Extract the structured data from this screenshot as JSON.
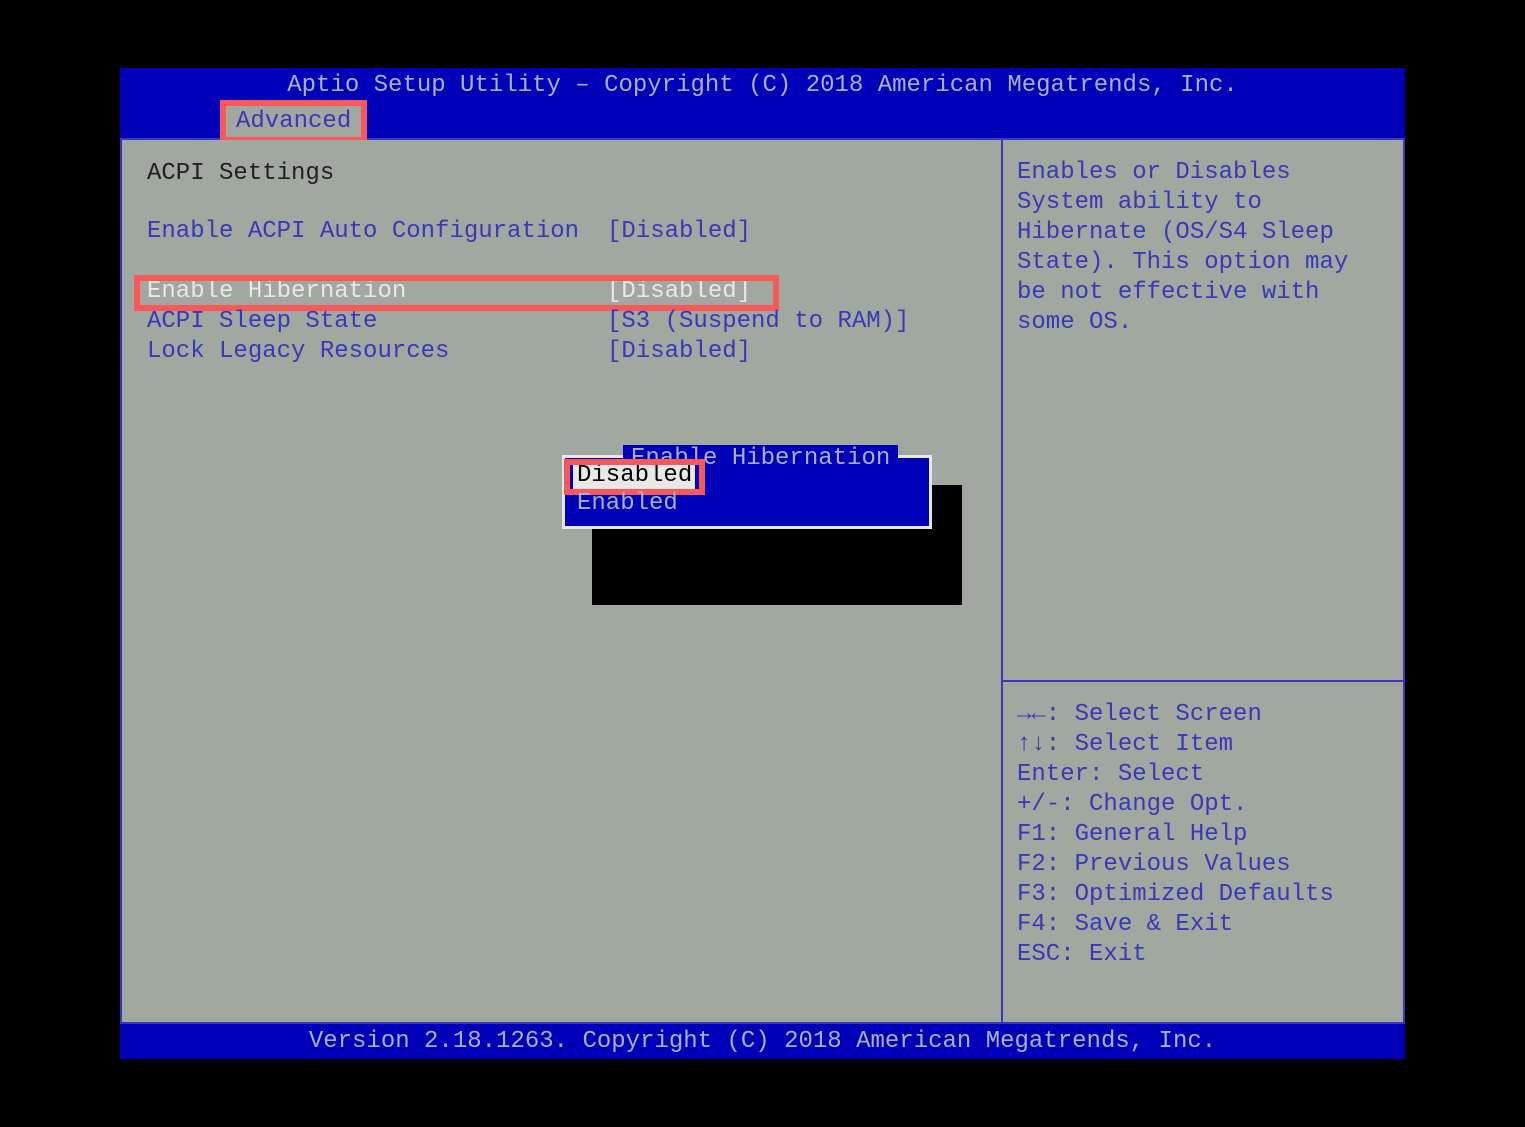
{
  "title": "Aptio Setup Utility – Copyright (C) 2018 American Megatrends, Inc.",
  "tab": "Advanced",
  "section_title": "ACPI Settings",
  "settings": [
    {
      "label": "Enable ACPI Auto Configuration",
      "value": "[Disabled]"
    },
    {
      "label": "Enable Hibernation",
      "value": "[Disabled]"
    },
    {
      "label": "ACPI Sleep State",
      "value": "[S3 (Suspend to RAM)]"
    },
    {
      "label": "Lock Legacy Resources",
      "value": "[Disabled]"
    }
  ],
  "help_text": "Enables or Disables System ability to Hibernate (OS/S4 Sleep State). This option may be not effective with some OS.",
  "keys": {
    "lr": "→←: Select Screen",
    "ud": "↑↓: Select Item",
    "enter": "Enter: Select",
    "pm": "+/-: Change Opt.",
    "f1": "F1: General Help",
    "f2": "F2: Previous Values",
    "f3": "F3: Optimized Defaults",
    "f4": "F4: Save & Exit",
    "esc": "ESC: Exit"
  },
  "popup": {
    "title": "Enable Hibernation",
    "options": [
      "Disabled",
      "Enabled"
    ],
    "selected": "Disabled"
  },
  "footer": "Version 2.18.1263. Copyright (C) 2018 American Megatrends, Inc."
}
